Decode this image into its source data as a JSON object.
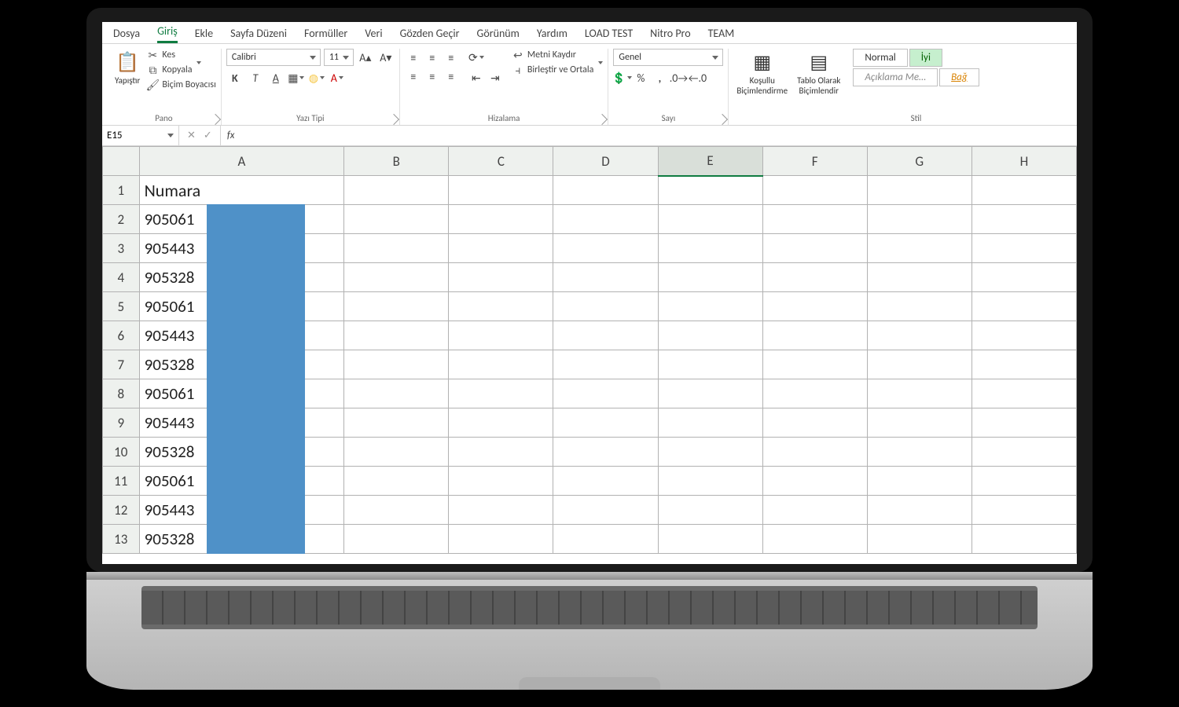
{
  "tabs": {
    "items": [
      "Dosya",
      "Giriş",
      "Ekle",
      "Sayfa Düzeni",
      "Formüller",
      "Veri",
      "Gözden Geçir",
      "Görünüm",
      "Yardım",
      "LOAD TEST",
      "Nitro Pro",
      "TEAM"
    ],
    "active_index": 1
  },
  "ribbon": {
    "pano": {
      "label": "Pano",
      "paste": "Yapıştır",
      "cut": "Kes",
      "copy": "Kopyala",
      "format_painter": "Biçim Boyacısı"
    },
    "font": {
      "label": "Yazı Tipi",
      "face": "Calibri",
      "size": "11",
      "bold": "K",
      "italic": "T",
      "underline": "A"
    },
    "align": {
      "label": "Hizalama",
      "wrap": "Metni Kaydır",
      "merge": "Birleştir ve Ortala"
    },
    "number": {
      "label": "Sayı",
      "format": "Genel"
    },
    "styles": {
      "label": "Stil",
      "conditional": "Koşullu\nBiçimlendirme",
      "table": "Tablo Olarak\nBiçimlendir",
      "normal": "Normal",
      "good": "İyi",
      "note": "Açıklama Me…",
      "bad": "Bağ"
    }
  },
  "fxbar": {
    "cell_ref": "E15",
    "fx": "fx"
  },
  "sheet": {
    "columns": [
      "A",
      "B",
      "C",
      "D",
      "E",
      "F",
      "G",
      "H"
    ],
    "active_col": "E",
    "header_cell": "Numara",
    "rows": [
      {
        "n": 1,
        "a": "Numara",
        "redact": false
      },
      {
        "n": 2,
        "a": "905061",
        "redact": true
      },
      {
        "n": 3,
        "a": "905443",
        "redact": true
      },
      {
        "n": 4,
        "a": "905328",
        "redact": true
      },
      {
        "n": 5,
        "a": "905061",
        "redact": true
      },
      {
        "n": 6,
        "a": "905443",
        "redact": true
      },
      {
        "n": 7,
        "a": "905328",
        "redact": true
      },
      {
        "n": 8,
        "a": "905061",
        "redact": true
      },
      {
        "n": 9,
        "a": "905443",
        "redact": true
      },
      {
        "n": 10,
        "a": "905328",
        "redact": true
      },
      {
        "n": 11,
        "a": "905061",
        "redact": true
      },
      {
        "n": 12,
        "a": "905443",
        "redact": true
      },
      {
        "n": 13,
        "a": "905328",
        "redact": true
      }
    ]
  }
}
